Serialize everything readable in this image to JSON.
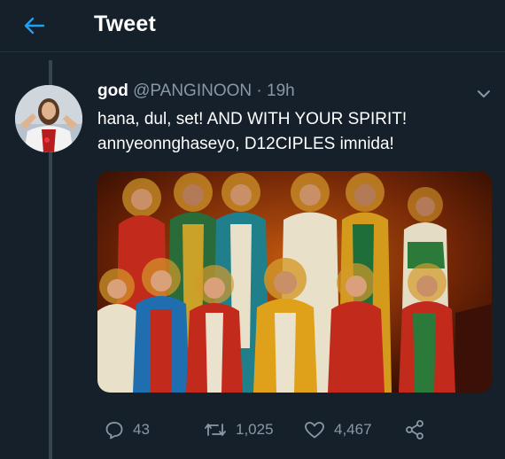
{
  "header": {
    "title": "Tweet",
    "back_icon": "arrow-left-icon"
  },
  "tweet": {
    "author_name": "god",
    "author_handle": "@PANGINOON",
    "separator": "·",
    "time": "19h",
    "line1": "hana, dul, set! AND WITH YOUR SPIRIT!",
    "line2": "annyeonnghaseyo, D12CIPLES imnida!",
    "media_icon": "disciples-painting"
  },
  "actions": {
    "replies": "43",
    "retweets": "1,025",
    "likes": "4,467"
  },
  "colors": {
    "background": "#15202b",
    "accent": "#1da1f2",
    "muted": "#8899a6"
  }
}
